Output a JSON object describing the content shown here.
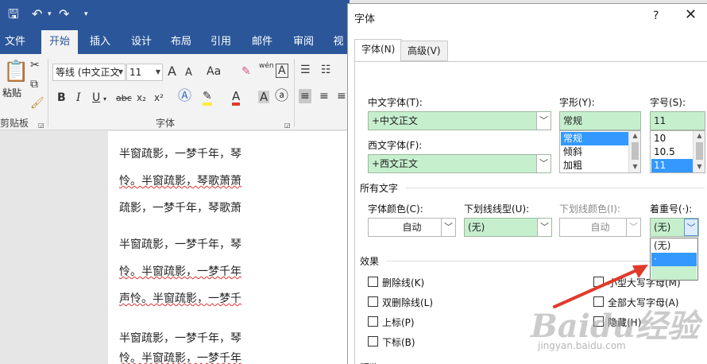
{
  "word": {
    "tabs": [
      "文件",
      "开始",
      "插入",
      "设计",
      "布局",
      "引用",
      "邮件",
      "审阅",
      "视"
    ],
    "active_tab_index": 1,
    "ribbon": {
      "paste_label": "粘贴",
      "font_name": "等线 (中文正文",
      "font_size": "11",
      "clipboard_label": "剪贴板",
      "font_group_label": "字体",
      "change_case_label": "Aa",
      "bold": "B",
      "italic": "I",
      "underline": "U",
      "strikethrough": "abc",
      "subscript": "x₂",
      "superscript": "x²",
      "grow_font": "A",
      "shrink_font": "A",
      "font_color": "A",
      "char_shading": "A",
      "phonetic": "wén",
      "char_border": "A"
    },
    "document_lines": [
      "半窗疏影，一梦千年，琴",
      "怜。半窗疏影，琴歌萧萧",
      "疏影，一梦千年，琴歌萧",
      "半窗疏影，一梦千年，琴",
      "怜。半窗疏影，一梦千年",
      "声怜。半窗疏影，一梦千",
      "半窗疏影，一梦千年，琴",
      "怜。半窗疏影，一梦千年"
    ]
  },
  "dialog": {
    "title": "字体",
    "help": "?",
    "close": "✕",
    "tabs": [
      "字体(N)",
      "高级(V)"
    ],
    "chinese_font_label": "中文字体(T):",
    "chinese_font_value": "+中文正文",
    "western_font_label": "西文字体(F):",
    "western_font_value": "+西文正文",
    "style_label": "字形(Y):",
    "style_value": "常规",
    "style_list": [
      "常规",
      "倾斜",
      "加粗"
    ],
    "size_label": "字号(S):",
    "size_value": "11",
    "size_list": [
      "10",
      "10.5",
      "11"
    ],
    "all_text_label": "所有文字",
    "font_color_label": "字体颜色(C):",
    "font_color_value": "自动",
    "underline_style_label": "下划线线型(U):",
    "underline_style_value": "(无)",
    "underline_color_label": "下划线颜色(I):",
    "underline_color_value": "自动",
    "emphasis_label": "着重号(·):",
    "emphasis_value": "(无)",
    "emphasis_options": [
      "(无)",
      "·",
      ""
    ],
    "effects_label": "效果",
    "effects_left": [
      "删除线(K)",
      "双删除线(L)",
      "上标(P)",
      "下标(B)"
    ],
    "effects_right": [
      "小型大写字母(M)",
      "全部大写字母(A)",
      "隐藏(H)"
    ],
    "preview_label": "预览"
  },
  "watermark": {
    "logo": "Baidu经验",
    "url": "jingyan.baidu.com"
  },
  "colors": {
    "word_blue": "#2b579a",
    "field_green": "#c6efce",
    "selection_blue": "#3399ff",
    "arrow_red": "#e03a2b"
  }
}
